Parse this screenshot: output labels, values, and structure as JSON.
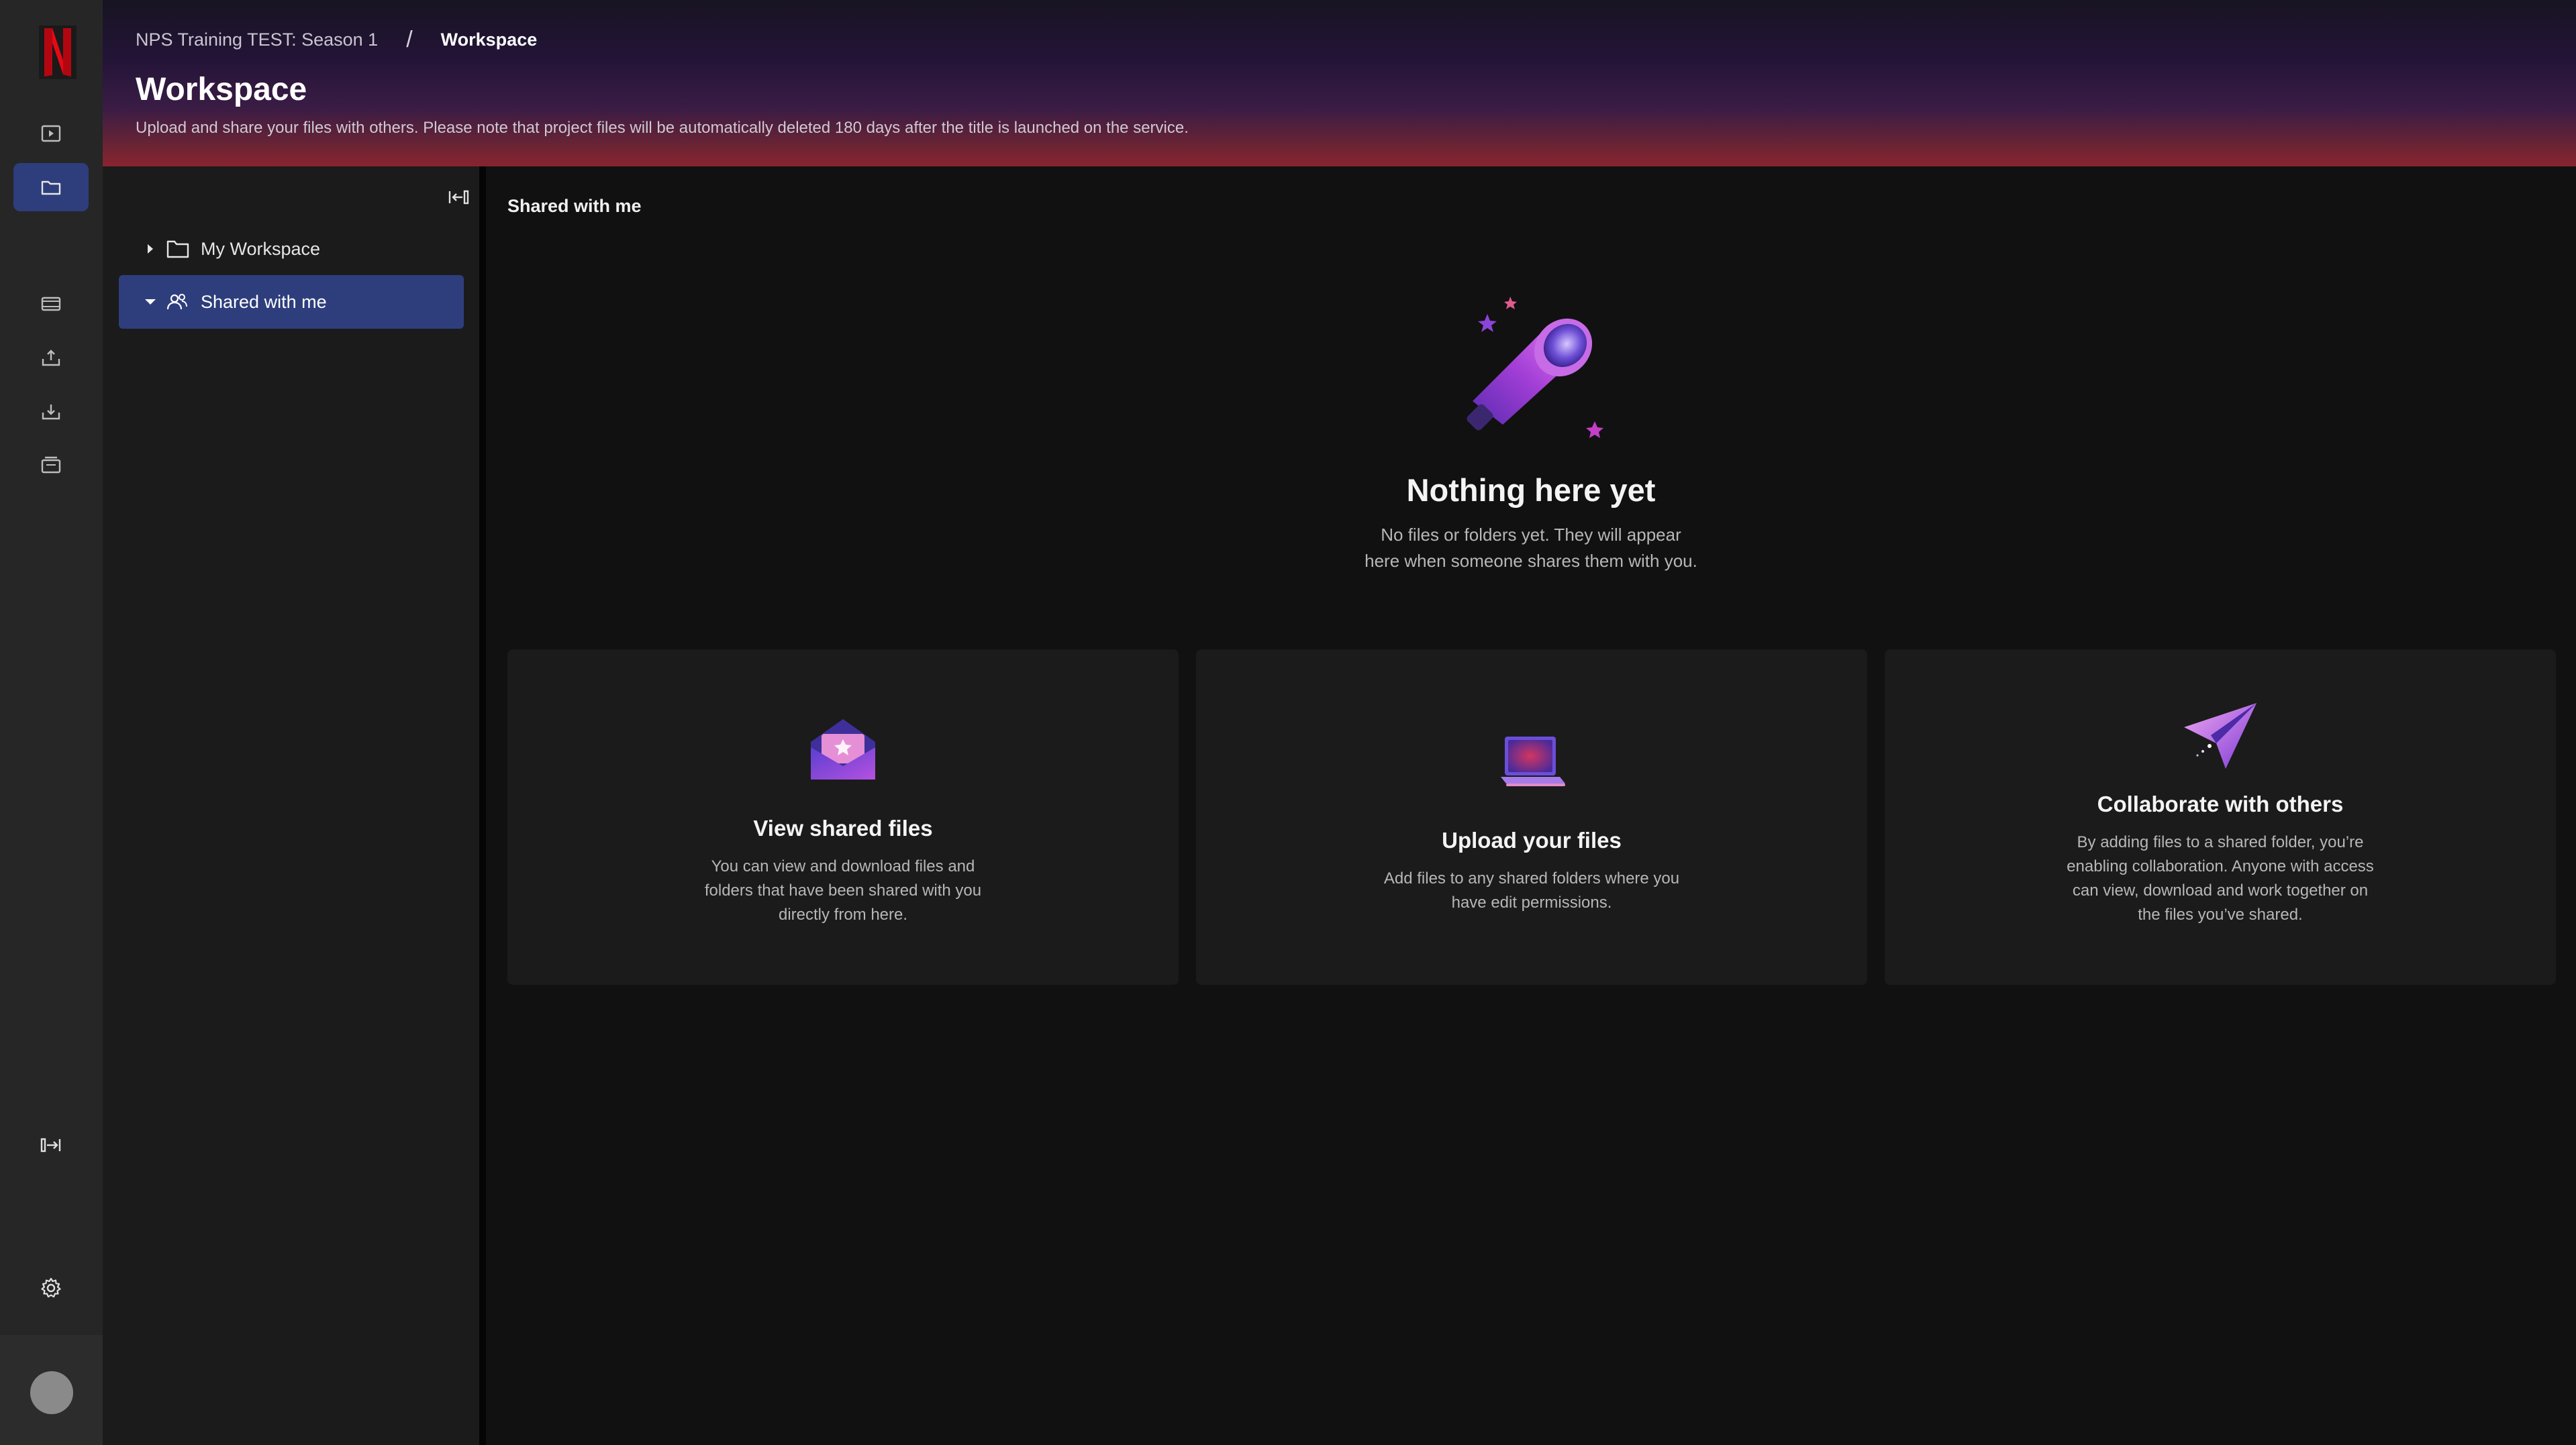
{
  "header": {
    "breadcrumb": [
      "NPS Training TEST: Season 1",
      "Workspace"
    ],
    "separator": "/",
    "title": "Workspace",
    "description": "Upload and share your files with others. Please note that project files will be automatically deleted 180 days after the title is launched on the service."
  },
  "tree": {
    "items": [
      {
        "label": "My Workspace",
        "icon": "folder-icon",
        "expanded": false
      },
      {
        "label": "Shared with me",
        "icon": "people-icon",
        "expanded": true,
        "selected": true
      }
    ]
  },
  "main": {
    "section_title": "Shared with me",
    "empty": {
      "title": "Nothing here yet",
      "description": "No files or folders yet. They will appear here when someone shares them with you."
    },
    "cards": [
      {
        "title": "View shared files",
        "description": "You can view and download files and folders that have been shared with you directly from here.",
        "icon": "envelope-icon"
      },
      {
        "title": "Upload your files",
        "description": "Add files to any shared folders where you have edit permissions.",
        "icon": "laptop-icon"
      },
      {
        "title": "Collaborate with others",
        "description": "By adding files to a shared folder, you’re enabling collaboration. Anyone with access can view, download and work together on the files you’ve shared.",
        "icon": "paper-plane-icon"
      }
    ]
  },
  "colors": {
    "brand": "#e50914",
    "selected": "#2e3e7c",
    "rail": "#262626",
    "card": "#1b1b1b"
  }
}
